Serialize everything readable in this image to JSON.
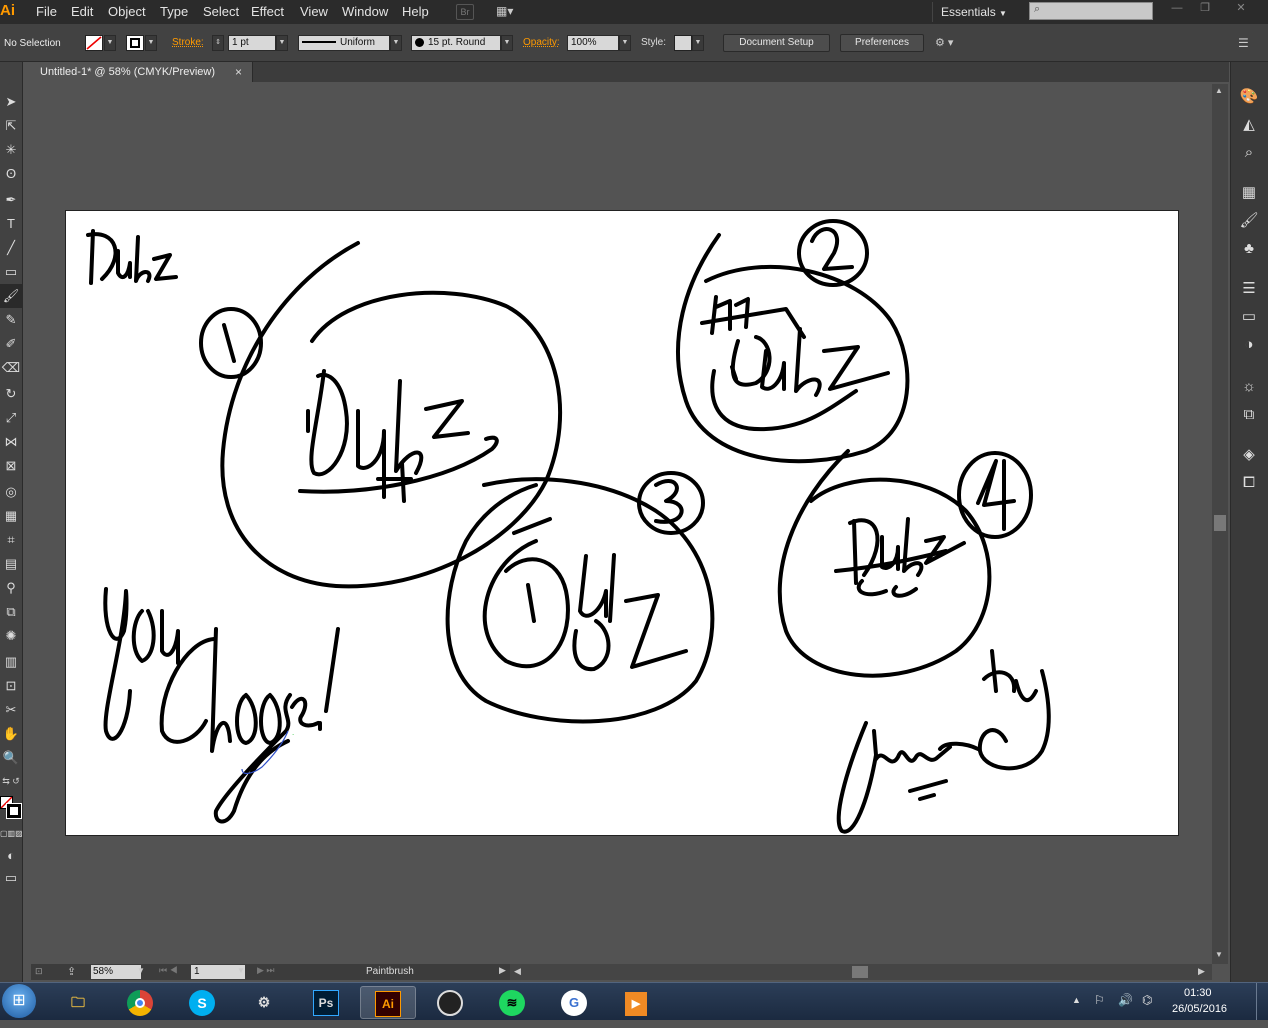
{
  "app": {
    "logo": "Ai"
  },
  "menu": [
    "File",
    "Edit",
    "Object",
    "Type",
    "Select",
    "Effect",
    "View",
    "Window",
    "Help"
  ],
  "bridge_label": "Br",
  "workspace": "Essentials",
  "control": {
    "selection": "No Selection",
    "stroke_label": "Stroke:",
    "stroke_weight": "1 pt",
    "profile": "Uniform",
    "brush": "15 pt. Round",
    "opacity_label": "Opacity:",
    "opacity": "100%",
    "style_label": "Style:",
    "doc_setup": "Document Setup",
    "preferences": "Preferences"
  },
  "doc_tab": {
    "title": "Untitled-1* @ 58% (CMYK/Preview)",
    "close": "×"
  },
  "status": {
    "zoom": "58%",
    "artboard": "1",
    "tool": "Paintbrush"
  },
  "clock": {
    "time": "01:30",
    "date": "26/05/2016"
  },
  "taskbar_apps": [
    {
      "name": "Ps",
      "color": "#31a8ff"
    },
    {
      "name": "Ai",
      "color": "#ff9a00"
    }
  ],
  "colors": {
    "accent": "#ff9a00",
    "artboard": "#ffffff",
    "pasteboard": "#535353"
  }
}
